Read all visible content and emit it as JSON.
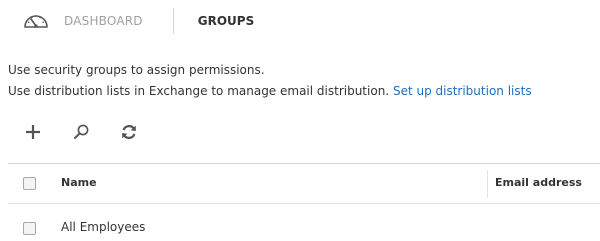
{
  "nav": {
    "dashboard_label": "DASHBOARD",
    "current_label": "GROUPS",
    "dashboard_icon": "speedometer-icon"
  },
  "description": {
    "line1": "Use security groups to assign permissions.",
    "line2": "Use distribution lists in Exchange to manage email distribution.",
    "link": "Set up distribution lists"
  },
  "toolbar": {
    "items": [
      {
        "icon": "plus-icon",
        "action": "add"
      },
      {
        "icon": "search-icon",
        "action": "search"
      },
      {
        "icon": "refresh-icon",
        "action": "refresh"
      }
    ]
  },
  "table": {
    "columns": [
      "Name",
      "Email address"
    ],
    "rows": [
      {
        "name": "All Employees",
        "email": ""
      }
    ]
  },
  "colors": {
    "text": "#333333",
    "muted": "#a0a0a0",
    "link": "#1e6fc1",
    "icon": "#555555",
    "border": "#d6d6d6"
  }
}
